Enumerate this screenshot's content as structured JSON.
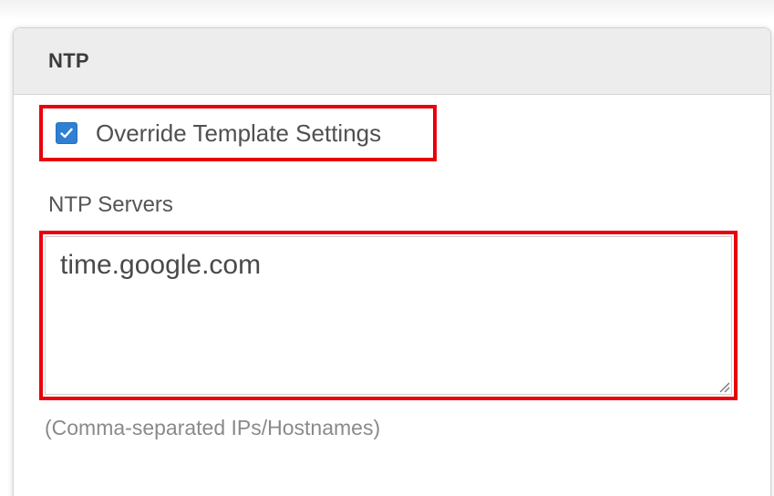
{
  "section": {
    "title": "NTP"
  },
  "override": {
    "label": "Override Template Settings",
    "checked": true
  },
  "ntp_servers": {
    "label": "NTP Servers",
    "value": "time.google.com",
    "help": "(Comma-separated IPs/Hostnames)"
  },
  "colors": {
    "highlight": "#e8000b",
    "checkbox": "#2f7fd3",
    "header_bg": "#ededed"
  },
  "icons": {
    "checkbox": "checkmark-icon",
    "resize": "resize-grip-icon"
  }
}
